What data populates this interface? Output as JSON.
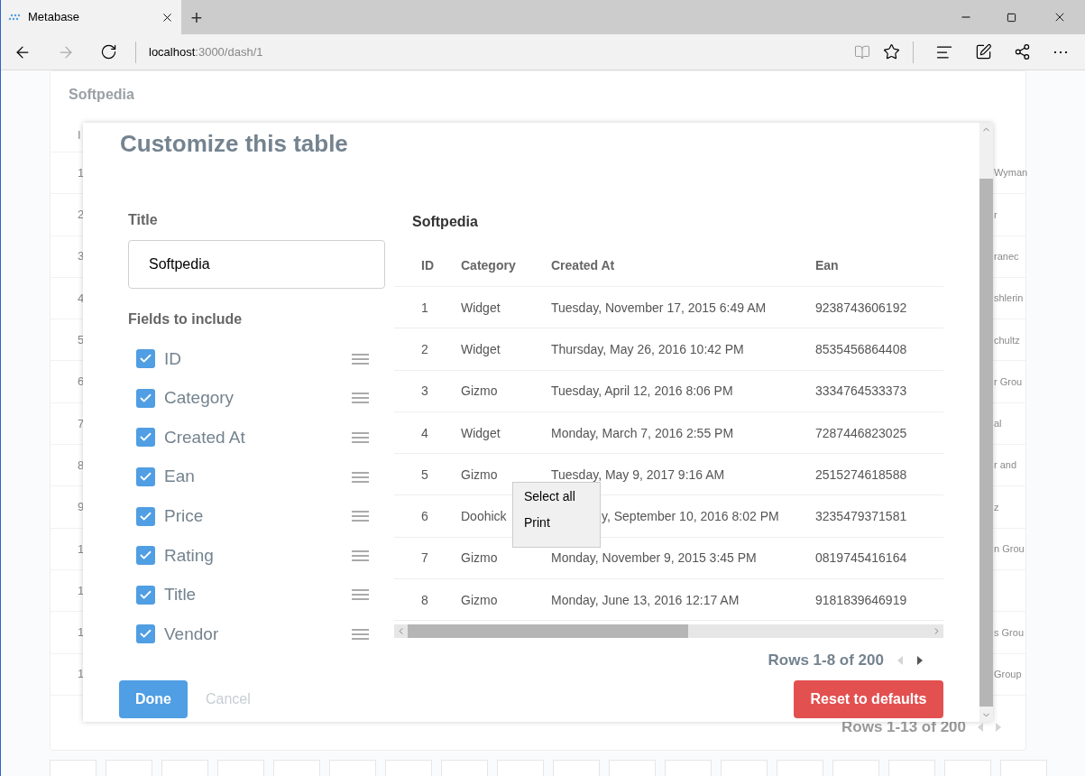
{
  "browser": {
    "tab_title": "Metabase",
    "new_tab": "+",
    "url_host": "localhost",
    "url_path": ":3000/dash/1",
    "more": "⋯"
  },
  "dashboard": {
    "card_title": "Softpedia",
    "left_cells": [
      "I",
      "1",
      "2",
      "3",
      "4",
      "5",
      "6",
      "7",
      "8",
      "9",
      "1",
      "1",
      "1",
      "1"
    ],
    "right_cells": [
      "Wyman",
      "r",
      "ranec",
      "shlerin",
      "chultz",
      "r Grou",
      "al",
      "r and",
      "z",
      "n Grou",
      "",
      "s Grou",
      "Group"
    ],
    "pagination": "Rows 1-13 of 200"
  },
  "modal": {
    "title": "Customize this table",
    "title_label": "Title",
    "title_value": "Softpedia",
    "fields_label": "Fields to include",
    "fields": [
      {
        "label": "ID",
        "checked": true
      },
      {
        "label": "Category",
        "checked": true
      },
      {
        "label": "Created At",
        "checked": true
      },
      {
        "label": "Ean",
        "checked": true
      },
      {
        "label": "Price",
        "checked": true
      },
      {
        "label": "Rating",
        "checked": true
      },
      {
        "label": "Title",
        "checked": true
      },
      {
        "label": "Vendor",
        "checked": true
      }
    ],
    "preview_title": "Softpedia",
    "table": {
      "columns": [
        "ID",
        "Category",
        "Created At",
        "Ean"
      ],
      "rows": [
        {
          "cells": [
            "1",
            "Widget",
            "Tuesday, November 17, 2015 6:49 AM",
            "9238743606192"
          ],
          "under_menu": false
        },
        {
          "cells": [
            "2",
            "Widget",
            "Thursday, May 26, 2016 10:42 PM",
            "8535456864408"
          ],
          "under_menu": false
        },
        {
          "cells": [
            "3",
            "Gizmo",
            "Tuesday, April 12, 2016 8:06 PM",
            "3334764533373"
          ],
          "under_menu": false
        },
        {
          "cells": [
            "4",
            "Widget",
            "Monday, March 7, 2016 2:55 PM",
            "7287446823025"
          ],
          "under_menu": false
        },
        {
          "cells": [
            "5",
            "Gizmo",
            "Tuesday, May 9, 2017 9:16 AM",
            "2515274618588"
          ],
          "under_menu": false
        },
        {
          "cells": [
            "6",
            "Doohick",
            "y, September 10, 2016 8:02 PM",
            "3235479371581"
          ],
          "under_menu": true
        },
        {
          "cells": [
            "7",
            "Gizmo",
            "Monday, November 9, 2015 3:45 PM",
            "0819745416164"
          ],
          "under_menu": false
        },
        {
          "cells": [
            "8",
            "Gizmo",
            "Monday, June 13, 2016 12:17 AM",
            "9181839646919"
          ],
          "under_menu": false
        }
      ]
    },
    "pagination": "Rows 1-8 of 200",
    "buttons": {
      "done": "Done",
      "cancel": "Cancel",
      "reset": "Reset to defaults"
    }
  },
  "context_menu": [
    "Select all",
    "Print"
  ]
}
